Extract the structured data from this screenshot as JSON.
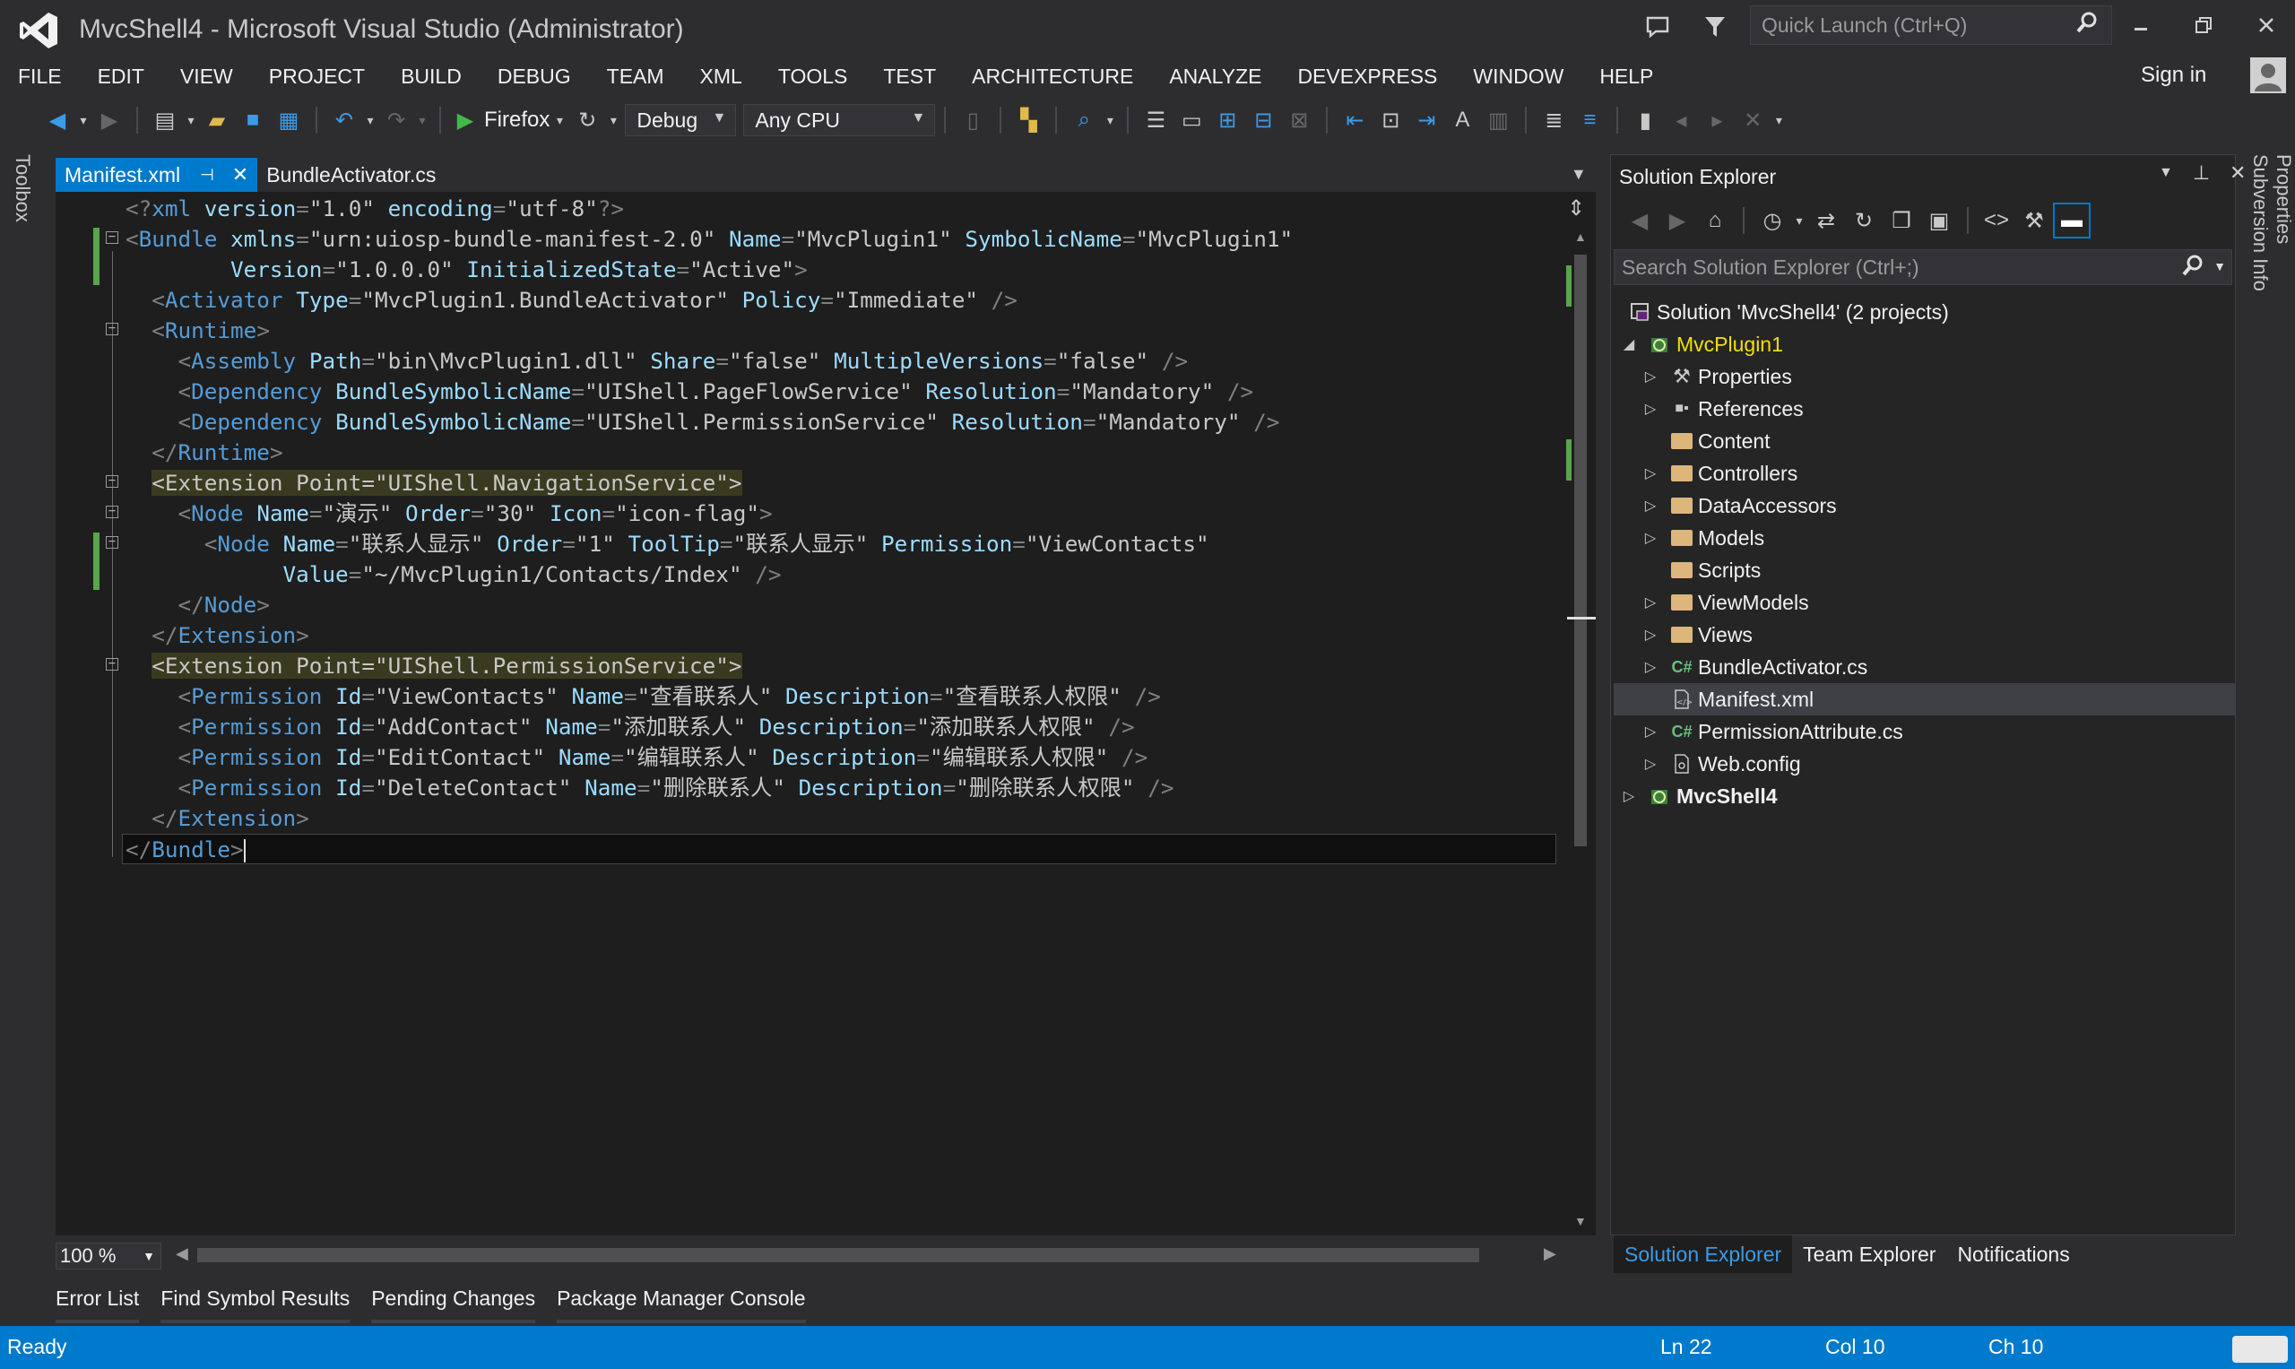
{
  "window": {
    "title": "MvcShell4 - Microsoft Visual Studio (Administrator)",
    "quick_launch_placeholder": "Quick Launch (Ctrl+Q)",
    "sign_in": "Sign in"
  },
  "menu": [
    "FILE",
    "EDIT",
    "VIEW",
    "PROJECT",
    "BUILD",
    "DEBUG",
    "TEAM",
    "XML",
    "TOOLS",
    "TEST",
    "ARCHITECTURE",
    "ANALYZE",
    "DEVEXPRESS",
    "WINDOW",
    "HELP"
  ],
  "toolbar": {
    "run_target": "Firefox",
    "configuration": "Debug",
    "platform": "Any CPU"
  },
  "side_rails": {
    "left": "Toolbox",
    "right": [
      "Properties",
      "Subversion Info"
    ]
  },
  "editor": {
    "tabs": [
      {
        "label": "Manifest.xml",
        "active": true
      },
      {
        "label": "BundleActivator.cs",
        "active": false
      }
    ],
    "zoom": "100 %",
    "lines": [
      [
        [
          "d",
          "<?"
        ],
        [
          "e",
          "xml"
        ],
        [
          "v",
          " "
        ],
        [
          "a",
          "version"
        ],
        [
          "d",
          "="
        ],
        [
          "q",
          "\""
        ],
        [
          "v",
          "1.0"
        ],
        [
          "q",
          "\""
        ],
        [
          "v",
          " "
        ],
        [
          "a",
          "encoding"
        ],
        [
          "d",
          "="
        ],
        [
          "q",
          "\""
        ],
        [
          "v",
          "utf-8"
        ],
        [
          "q",
          "\""
        ],
        [
          "d",
          "?>"
        ]
      ],
      [
        [
          "d",
          "<"
        ],
        [
          "e",
          "Bundle"
        ],
        [
          "v",
          " "
        ],
        [
          "a",
          "xmlns"
        ],
        [
          "d",
          "="
        ],
        [
          "q",
          "\""
        ],
        [
          "v",
          "urn:uiosp-bundle-manifest-2.0"
        ],
        [
          "q",
          "\""
        ],
        [
          "v",
          " "
        ],
        [
          "a",
          "Name"
        ],
        [
          "d",
          "="
        ],
        [
          "q",
          "\""
        ],
        [
          "v",
          "MvcPlugin1"
        ],
        [
          "q",
          "\""
        ],
        [
          "v",
          " "
        ],
        [
          "a",
          "SymbolicName"
        ],
        [
          "d",
          "="
        ],
        [
          "q",
          "\""
        ],
        [
          "v",
          "MvcPlugin1"
        ],
        [
          "q",
          "\""
        ]
      ],
      [
        [
          "v",
          "        "
        ],
        [
          "a",
          "Version"
        ],
        [
          "d",
          "="
        ],
        [
          "q",
          "\""
        ],
        [
          "v",
          "1.0.0.0"
        ],
        [
          "q",
          "\""
        ],
        [
          "v",
          " "
        ],
        [
          "a",
          "InitializedState"
        ],
        [
          "d",
          "="
        ],
        [
          "q",
          "\""
        ],
        [
          "v",
          "Active"
        ],
        [
          "q",
          "\""
        ],
        [
          "d",
          ">"
        ]
      ],
      [
        [
          "v",
          "  "
        ],
        [
          "d",
          "<"
        ],
        [
          "e",
          "Activator"
        ],
        [
          "v",
          " "
        ],
        [
          "a",
          "Type"
        ],
        [
          "d",
          "="
        ],
        [
          "q",
          "\""
        ],
        [
          "v",
          "MvcPlugin1.BundleActivator"
        ],
        [
          "q",
          "\""
        ],
        [
          "v",
          " "
        ],
        [
          "a",
          "Policy"
        ],
        [
          "d",
          "="
        ],
        [
          "q",
          "\""
        ],
        [
          "v",
          "Immediate"
        ],
        [
          "q",
          "\""
        ],
        [
          "v",
          " "
        ],
        [
          "d",
          "/>"
        ]
      ],
      [
        [
          "v",
          "  "
        ],
        [
          "d",
          "<"
        ],
        [
          "e",
          "Runtime"
        ],
        [
          "d",
          ">"
        ]
      ],
      [
        [
          "v",
          "    "
        ],
        [
          "d",
          "<"
        ],
        [
          "e",
          "Assembly"
        ],
        [
          "v",
          " "
        ],
        [
          "a",
          "Path"
        ],
        [
          "d",
          "="
        ],
        [
          "q",
          "\""
        ],
        [
          "v",
          "bin\\MvcPlugin1.dll"
        ],
        [
          "q",
          "\""
        ],
        [
          "v",
          " "
        ],
        [
          "a",
          "Share"
        ],
        [
          "d",
          "="
        ],
        [
          "q",
          "\""
        ],
        [
          "v",
          "false"
        ],
        [
          "q",
          "\""
        ],
        [
          "v",
          " "
        ],
        [
          "a",
          "MultipleVersions"
        ],
        [
          "d",
          "="
        ],
        [
          "q",
          "\""
        ],
        [
          "v",
          "false"
        ],
        [
          "q",
          "\""
        ],
        [
          "v",
          " "
        ],
        [
          "d",
          "/>"
        ]
      ],
      [
        [
          "v",
          "    "
        ],
        [
          "d",
          "<"
        ],
        [
          "e",
          "Dependency"
        ],
        [
          "v",
          " "
        ],
        [
          "a",
          "BundleSymbolicName"
        ],
        [
          "d",
          "="
        ],
        [
          "q",
          "\""
        ],
        [
          "v",
          "UIShell.PageFlowService"
        ],
        [
          "q",
          "\""
        ],
        [
          "v",
          " "
        ],
        [
          "a",
          "Resolution"
        ],
        [
          "d",
          "="
        ],
        [
          "q",
          "\""
        ],
        [
          "v",
          "Mandatory"
        ],
        [
          "q",
          "\""
        ],
        [
          "v",
          " "
        ],
        [
          "d",
          "/>"
        ]
      ],
      [
        [
          "v",
          "    "
        ],
        [
          "d",
          "<"
        ],
        [
          "e",
          "Dependency"
        ],
        [
          "v",
          " "
        ],
        [
          "a",
          "BundleSymbolicName"
        ],
        [
          "d",
          "="
        ],
        [
          "q",
          "\""
        ],
        [
          "v",
          "UIShell.PermissionService"
        ],
        [
          "q",
          "\""
        ],
        [
          "v",
          " "
        ],
        [
          "a",
          "Resolution"
        ],
        [
          "d",
          "="
        ],
        [
          "q",
          "\""
        ],
        [
          "v",
          "Mandatory"
        ],
        [
          "q",
          "\""
        ],
        [
          "v",
          " "
        ],
        [
          "d",
          "/>"
        ]
      ],
      [
        [
          "v",
          "  "
        ],
        [
          "d",
          "</"
        ],
        [
          "e",
          "Runtime"
        ],
        [
          "d",
          ">"
        ]
      ],
      [
        [
          "v",
          "  "
        ],
        [
          "hl",
          "<Extension Point=\"UIShell.NavigationService\">"
        ]
      ],
      [
        [
          "v",
          "    "
        ],
        [
          "d",
          "<"
        ],
        [
          "e",
          "Node"
        ],
        [
          "v",
          " "
        ],
        [
          "a",
          "Name"
        ],
        [
          "d",
          "="
        ],
        [
          "q",
          "\""
        ],
        [
          "v",
          "演示"
        ],
        [
          "q",
          "\""
        ],
        [
          "v",
          " "
        ],
        [
          "a",
          "Order"
        ],
        [
          "d",
          "="
        ],
        [
          "q",
          "\""
        ],
        [
          "v",
          "30"
        ],
        [
          "q",
          "\""
        ],
        [
          "v",
          " "
        ],
        [
          "a",
          "Icon"
        ],
        [
          "d",
          "="
        ],
        [
          "q",
          "\""
        ],
        [
          "v",
          "icon-flag"
        ],
        [
          "q",
          "\""
        ],
        [
          "d",
          ">"
        ]
      ],
      [
        [
          "v",
          "      "
        ],
        [
          "d",
          "<"
        ],
        [
          "e",
          "Node"
        ],
        [
          "v",
          " "
        ],
        [
          "a",
          "Name"
        ],
        [
          "d",
          "="
        ],
        [
          "q",
          "\""
        ],
        [
          "v",
          "联系人显示"
        ],
        [
          "q",
          "\""
        ],
        [
          "v",
          " "
        ],
        [
          "a",
          "Order"
        ],
        [
          "d",
          "="
        ],
        [
          "q",
          "\""
        ],
        [
          "v",
          "1"
        ],
        [
          "q",
          "\""
        ],
        [
          "v",
          " "
        ],
        [
          "a",
          "ToolTip"
        ],
        [
          "d",
          "="
        ],
        [
          "q",
          "\""
        ],
        [
          "v",
          "联系人显示"
        ],
        [
          "q",
          "\""
        ],
        [
          "v",
          " "
        ],
        [
          "a",
          "Permission"
        ],
        [
          "d",
          "="
        ],
        [
          "q",
          "\""
        ],
        [
          "v",
          "ViewContacts"
        ],
        [
          "q",
          "\""
        ]
      ],
      [
        [
          "v",
          "            "
        ],
        [
          "a",
          "Value"
        ],
        [
          "d",
          "="
        ],
        [
          "q",
          "\""
        ],
        [
          "v",
          "~/MvcPlugin1/Contacts/Index"
        ],
        [
          "q",
          "\""
        ],
        [
          "v",
          " "
        ],
        [
          "d",
          "/>"
        ]
      ],
      [
        [
          "v",
          "    "
        ],
        [
          "d",
          "</"
        ],
        [
          "e",
          "Node"
        ],
        [
          "d",
          ">"
        ]
      ],
      [
        [
          "v",
          "  "
        ],
        [
          "d",
          "</"
        ],
        [
          "e",
          "Extension"
        ],
        [
          "d",
          ">"
        ]
      ],
      [
        [
          "v",
          "  "
        ],
        [
          "hl",
          "<Extension Point=\"UIShell.PermissionService\">"
        ]
      ],
      [
        [
          "v",
          "    "
        ],
        [
          "d",
          "<"
        ],
        [
          "e",
          "Permission"
        ],
        [
          "v",
          " "
        ],
        [
          "a",
          "Id"
        ],
        [
          "d",
          "="
        ],
        [
          "q",
          "\""
        ],
        [
          "v",
          "ViewContacts"
        ],
        [
          "q",
          "\""
        ],
        [
          "v",
          " "
        ],
        [
          "a",
          "Name"
        ],
        [
          "d",
          "="
        ],
        [
          "q",
          "\""
        ],
        [
          "v",
          "查看联系人"
        ],
        [
          "q",
          "\""
        ],
        [
          "v",
          " "
        ],
        [
          "a",
          "Description"
        ],
        [
          "d",
          "="
        ],
        [
          "q",
          "\""
        ],
        [
          "v",
          "查看联系人权限"
        ],
        [
          "q",
          "\""
        ],
        [
          "v",
          " "
        ],
        [
          "d",
          "/>"
        ]
      ],
      [
        [
          "v",
          "    "
        ],
        [
          "d",
          "<"
        ],
        [
          "e",
          "Permission"
        ],
        [
          "v",
          " "
        ],
        [
          "a",
          "Id"
        ],
        [
          "d",
          "="
        ],
        [
          "q",
          "\""
        ],
        [
          "v",
          "AddContact"
        ],
        [
          "q",
          "\""
        ],
        [
          "v",
          " "
        ],
        [
          "a",
          "Name"
        ],
        [
          "d",
          "="
        ],
        [
          "q",
          "\""
        ],
        [
          "v",
          "添加联系人"
        ],
        [
          "q",
          "\""
        ],
        [
          "v",
          " "
        ],
        [
          "a",
          "Description"
        ],
        [
          "d",
          "="
        ],
        [
          "q",
          "\""
        ],
        [
          "v",
          "添加联系人权限"
        ],
        [
          "q",
          "\""
        ],
        [
          "v",
          " "
        ],
        [
          "d",
          "/>"
        ]
      ],
      [
        [
          "v",
          "    "
        ],
        [
          "d",
          "<"
        ],
        [
          "e",
          "Permission"
        ],
        [
          "v",
          " "
        ],
        [
          "a",
          "Id"
        ],
        [
          "d",
          "="
        ],
        [
          "q",
          "\""
        ],
        [
          "v",
          "EditContact"
        ],
        [
          "q",
          "\""
        ],
        [
          "v",
          " "
        ],
        [
          "a",
          "Name"
        ],
        [
          "d",
          "="
        ],
        [
          "q",
          "\""
        ],
        [
          "v",
          "编辑联系人"
        ],
        [
          "q",
          "\""
        ],
        [
          "v",
          " "
        ],
        [
          "a",
          "Description"
        ],
        [
          "d",
          "="
        ],
        [
          "q",
          "\""
        ],
        [
          "v",
          "编辑联系人权限"
        ],
        [
          "q",
          "\""
        ],
        [
          "v",
          " "
        ],
        [
          "d",
          "/>"
        ]
      ],
      [
        [
          "v",
          "    "
        ],
        [
          "d",
          "<"
        ],
        [
          "e",
          "Permission"
        ],
        [
          "v",
          " "
        ],
        [
          "a",
          "Id"
        ],
        [
          "d",
          "="
        ],
        [
          "q",
          "\""
        ],
        [
          "v",
          "DeleteContact"
        ],
        [
          "q",
          "\""
        ],
        [
          "v",
          " "
        ],
        [
          "a",
          "Name"
        ],
        [
          "d",
          "="
        ],
        [
          "q",
          "\""
        ],
        [
          "v",
          "删除联系人"
        ],
        [
          "q",
          "\""
        ],
        [
          "v",
          " "
        ],
        [
          "a",
          "Description"
        ],
        [
          "d",
          "="
        ],
        [
          "q",
          "\""
        ],
        [
          "v",
          "删除联系人权限"
        ],
        [
          "q",
          "\""
        ],
        [
          "v",
          " "
        ],
        [
          "d",
          "/>"
        ]
      ],
      [
        [
          "v",
          "  "
        ],
        [
          "d",
          "</"
        ],
        [
          "e",
          "Extension"
        ],
        [
          "d",
          ">"
        ]
      ],
      [
        [
          "d",
          "</"
        ],
        [
          "e",
          "Bundle"
        ],
        [
          "d",
          ">"
        ],
        [
          "caret",
          ""
        ]
      ]
    ]
  },
  "bottom_tabs": [
    "Error List",
    "Find Symbol Results",
    "Pending Changes",
    "Package Manager Console"
  ],
  "status": {
    "text": "Ready",
    "ln": "Ln 22",
    "col": "Col 10",
    "ch": "Ch 10"
  },
  "solution_explorer": {
    "title": "Solution Explorer",
    "search_placeholder": "Search Solution Explorer (Ctrl+;)",
    "tree": [
      {
        "label": "Solution 'MvcShell4' (2 projects)",
        "level": 0,
        "expander": "",
        "icon": "solution-icon"
      },
      {
        "label": "MvcPlugin1",
        "level": 0,
        "expander": "expanded",
        "icon": "web-project-icon",
        "project": true
      },
      {
        "label": "Properties",
        "level": 1,
        "expander": "collapsed",
        "icon": "wrench-icon"
      },
      {
        "label": "References",
        "level": 1,
        "expander": "collapsed",
        "icon": "references-icon"
      },
      {
        "label": "Content",
        "level": 1,
        "expander": "",
        "icon": "folder-icon"
      },
      {
        "label": "Controllers",
        "level": 1,
        "expander": "collapsed",
        "icon": "folder-icon"
      },
      {
        "label": "DataAccessors",
        "level": 1,
        "expander": "collapsed",
        "icon": "folder-icon"
      },
      {
        "label": "Models",
        "level": 1,
        "expander": "collapsed",
        "icon": "folder-icon"
      },
      {
        "label": "Scripts",
        "level": 1,
        "expander": "",
        "icon": "folder-icon"
      },
      {
        "label": "ViewModels",
        "level": 1,
        "expander": "collapsed",
        "icon": "folder-icon"
      },
      {
        "label": "Views",
        "level": 1,
        "expander": "collapsed",
        "icon": "folder-icon"
      },
      {
        "label": "BundleActivator.cs",
        "level": 1,
        "expander": "collapsed",
        "icon": "csharp-file-icon"
      },
      {
        "label": "Manifest.xml",
        "level": 1,
        "expander": "",
        "icon": "xml-file-icon",
        "selected": true
      },
      {
        "label": "PermissionAttribute.cs",
        "level": 1,
        "expander": "collapsed",
        "icon": "csharp-file-icon"
      },
      {
        "label": "Web.config",
        "level": 1,
        "expander": "collapsed",
        "icon": "config-file-icon"
      },
      {
        "label": "MvcShell4",
        "level": 0,
        "expander": "collapsed",
        "icon": "web-project-icon",
        "bold": true
      }
    ],
    "tabs": [
      {
        "label": "Solution Explorer",
        "active": true
      },
      {
        "label": "Team Explorer",
        "active": false
      },
      {
        "label": "Notifications",
        "active": false
      }
    ]
  }
}
